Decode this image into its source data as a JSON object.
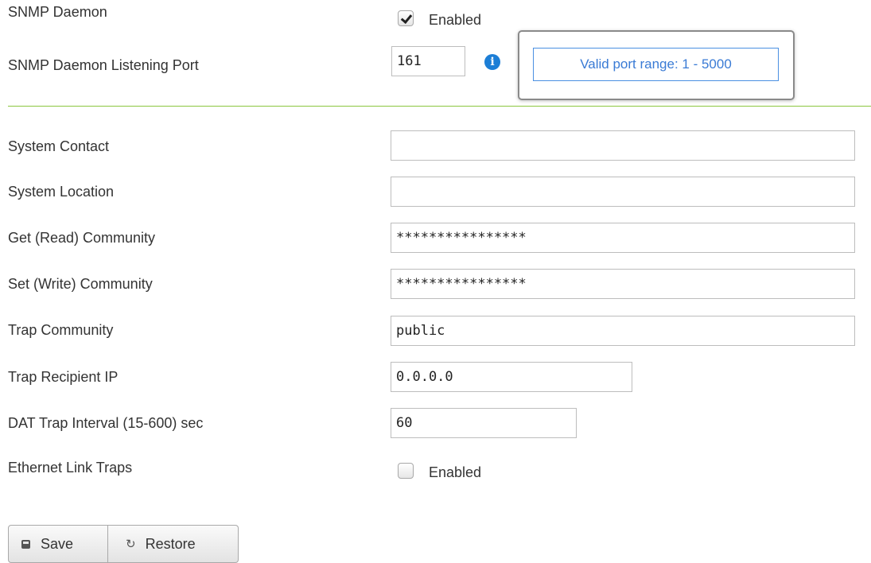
{
  "snmp": {
    "daemon_label": "SNMP Daemon",
    "daemon_enabled_text": "Enabled",
    "daemon_enabled": true,
    "port_label": "SNMP Daemon Listening Port",
    "port_value": "161",
    "info_glyph": "i",
    "port_tooltip": "Valid port range: 1 - 5000"
  },
  "fields": {
    "system_contact": {
      "label": "System Contact",
      "value": ""
    },
    "system_location": {
      "label": "System Location",
      "value": ""
    },
    "get_community": {
      "label": "Get (Read) Community",
      "value": "****************"
    },
    "set_community": {
      "label": "Set (Write) Community",
      "value": "****************"
    },
    "trap_community": {
      "label": "Trap Community",
      "value": "public"
    },
    "trap_recipient_ip": {
      "label": "Trap Recipient IP",
      "value": "0.0.0.0"
    },
    "dat_trap_interval": {
      "label": "DAT Trap Interval (15-600) sec",
      "value": "60"
    },
    "ethernet_link_traps": {
      "label": "Ethernet Link Traps",
      "enabled_text": "Enabled",
      "enabled": false
    }
  },
  "actions": {
    "save_label": "Save",
    "restore_label": "Restore",
    "save_icon": "save-icon",
    "restore_icon": "restore-icon"
  },
  "colors": {
    "divider": "#8cc63f",
    "info_icon": "#1c7ed6",
    "tooltip_text": "#3a7bd5"
  }
}
